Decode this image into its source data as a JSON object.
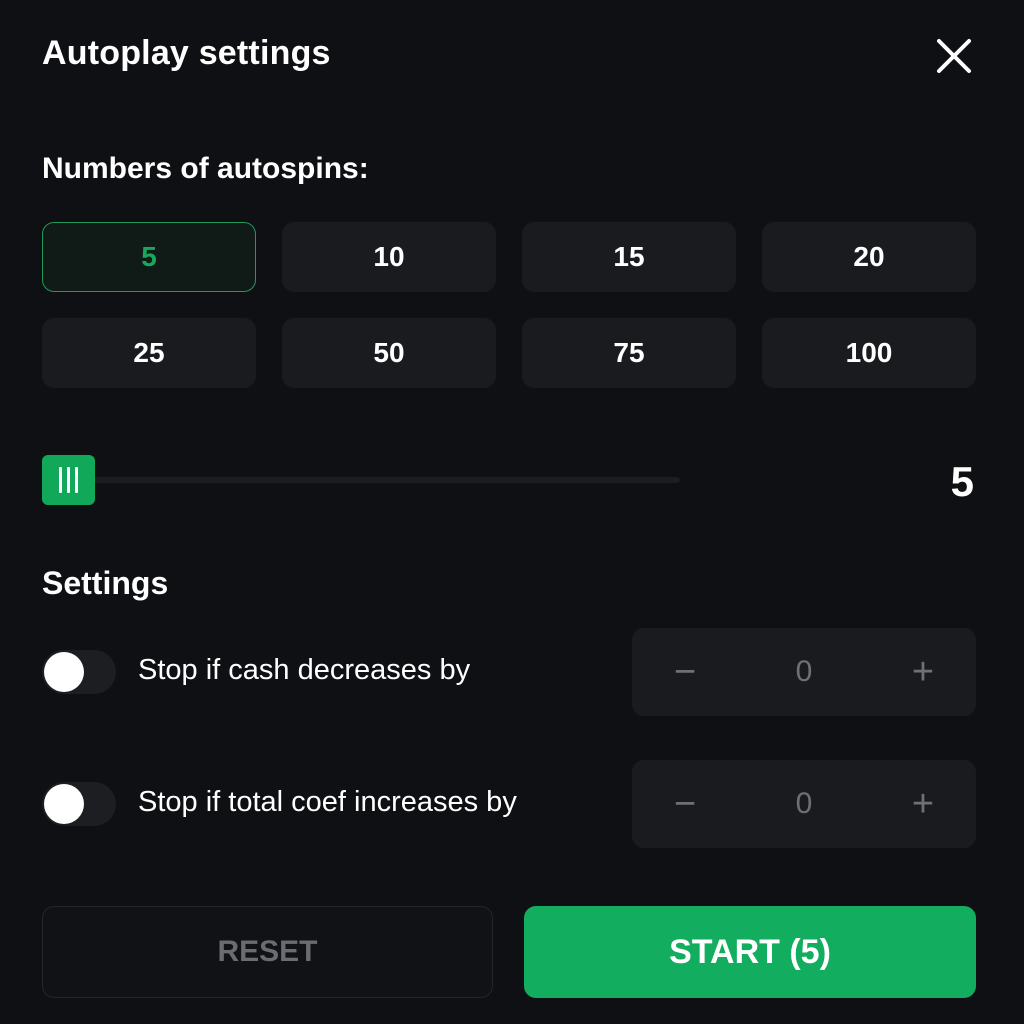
{
  "header": {
    "title": "Autoplay settings",
    "close_icon": "close-icon"
  },
  "autospins": {
    "label": "Numbers of autospins:",
    "options": [
      "5",
      "10",
      "15",
      "20",
      "25",
      "50",
      "75",
      "100"
    ],
    "selected": "5"
  },
  "slider": {
    "value": "5",
    "fraction": 0.0
  },
  "settings": {
    "label": "Settings",
    "rows": [
      {
        "label": "Stop if cash decreases by",
        "enabled": false,
        "value": "0",
        "minus": "−",
        "plus": "+"
      },
      {
        "label": "Stop if total coef increases by",
        "enabled": false,
        "value": "0",
        "minus": "−",
        "plus": "+"
      }
    ]
  },
  "footer": {
    "reset_label": "RESET",
    "start_label": "START (5)"
  },
  "colors": {
    "accent": "#12ad5e",
    "background": "#0f1013",
    "button_bg": "#1a1b1f",
    "muted_text": "#6f7075"
  }
}
